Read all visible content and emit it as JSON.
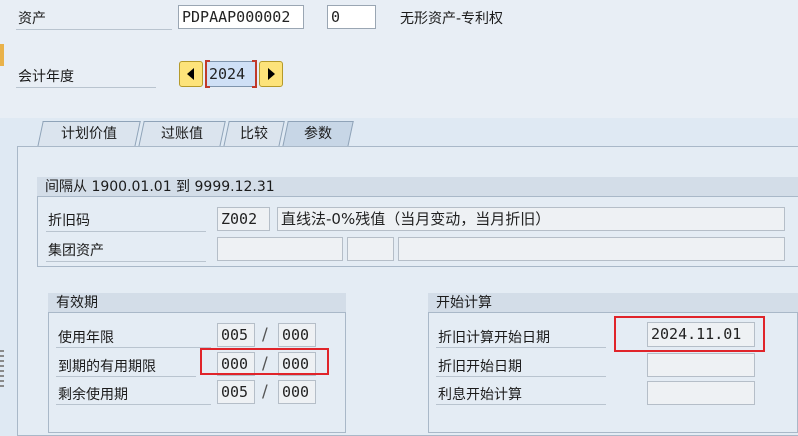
{
  "header": {
    "asset_label": "资产",
    "asset_number": "PDPAAP000002",
    "asset_sub": "0",
    "asset_desc": "无形资产-专利权",
    "fiscal_year_label": "会计年度",
    "fiscal_year": "2024"
  },
  "tabs": [
    {
      "label": "计划价值"
    },
    {
      "label": "过账值"
    },
    {
      "label": "比较"
    },
    {
      "label": "参数"
    }
  ],
  "params": {
    "interval_title": "间隔从 1900.01.01 到 9999.12.31",
    "dep_key_label": "折旧码",
    "dep_key": "Z002",
    "dep_key_desc": "直线法-0%残值（当月变动，当月折旧）",
    "group_asset_label": "集团资产",
    "validity": {
      "title": "有效期",
      "useful_life_label": "使用年限",
      "useful_life_years": "005",
      "useful_life_periods": "000",
      "expired_life_label": "到期的有用期限",
      "expired_years": "000",
      "expired_periods": "000",
      "remaining_life_label": "剩余使用期",
      "remaining_years": "005",
      "remaining_periods": "000",
      "separator": "/"
    },
    "start": {
      "title": "开始计算",
      "dep_start_label": "折旧计算开始日期",
      "dep_start_date": "2024.11.01",
      "ord_dep_start_label": "折旧开始日期",
      "interest_start_label": "利息开始计算"
    }
  },
  "colors": {
    "highlight": "#e0242a",
    "nav_button": "#fde37a"
  },
  "icons": {
    "prev": "triangle-left",
    "next": "triangle-right"
  }
}
